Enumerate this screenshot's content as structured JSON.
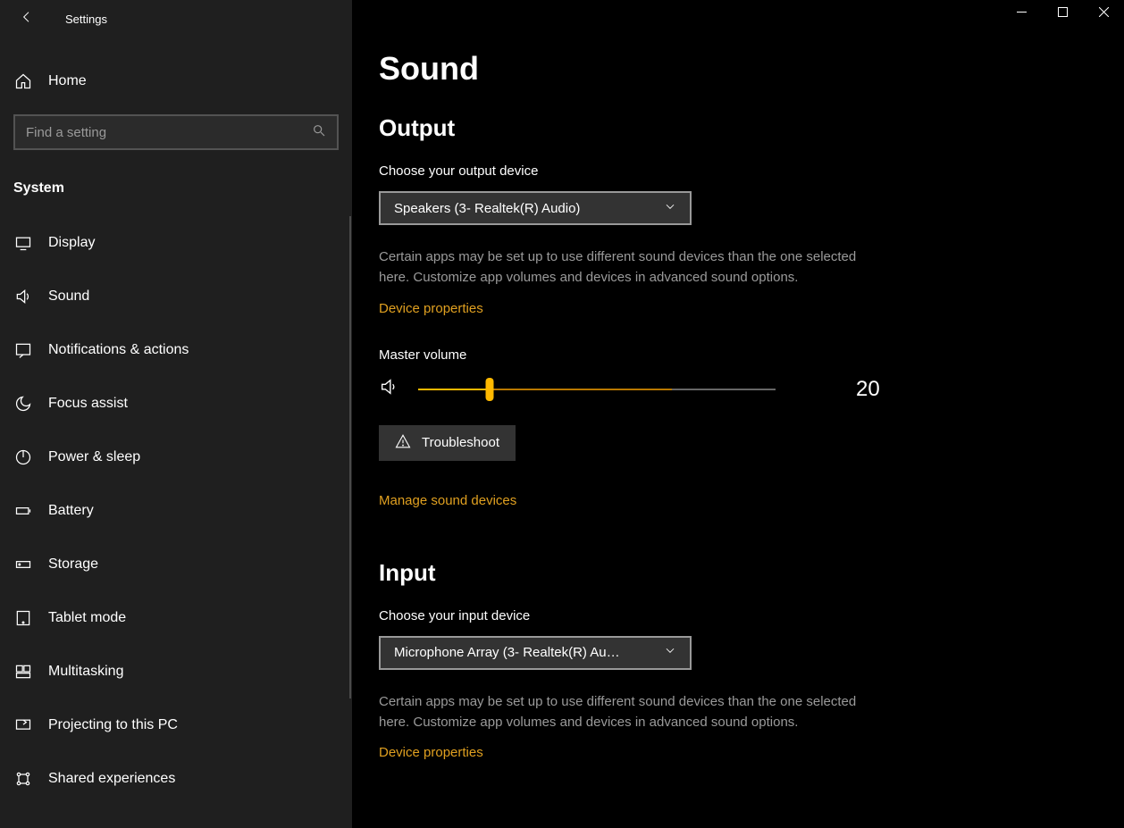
{
  "window": {
    "title": "Settings"
  },
  "sidebar": {
    "home": "Home",
    "search_placeholder": "Find a setting",
    "category": "System",
    "items": [
      {
        "id": "display",
        "icon": "display",
        "label": "Display"
      },
      {
        "id": "sound",
        "icon": "sound",
        "label": "Sound"
      },
      {
        "id": "notifications",
        "icon": "notifications",
        "label": "Notifications & actions"
      },
      {
        "id": "focus-assist",
        "icon": "focus-assist",
        "label": "Focus assist"
      },
      {
        "id": "power-sleep",
        "icon": "power-sleep",
        "label": "Power & sleep"
      },
      {
        "id": "battery",
        "icon": "battery",
        "label": "Battery"
      },
      {
        "id": "storage",
        "icon": "storage",
        "label": "Storage"
      },
      {
        "id": "tablet-mode",
        "icon": "tablet-mode",
        "label": "Tablet mode"
      },
      {
        "id": "multitasking",
        "icon": "multitasking",
        "label": "Multitasking"
      },
      {
        "id": "projecting",
        "icon": "projecting",
        "label": "Projecting to this PC"
      },
      {
        "id": "shared-exp",
        "icon": "shared-exp",
        "label": "Shared experiences"
      }
    ]
  },
  "main": {
    "page_title": "Sound",
    "output": {
      "heading": "Output",
      "choose_label": "Choose your output device",
      "selected": "Speakers (3- Realtek(R) Audio)",
      "help": "Certain apps may be set up to use different sound devices than the one selected here. Customize app volumes and devices in advanced sound options.",
      "device_properties": "Device properties",
      "master_volume_label": "Master volume",
      "volume_value": "20",
      "troubleshoot": "Troubleshoot",
      "manage_devices": "Manage sound devices"
    },
    "input": {
      "heading": "Input",
      "choose_label": "Choose your input device",
      "selected": "Microphone Array (3- Realtek(R) Au…",
      "help": "Certain apps may be set up to use different sound devices than the one selected here. Customize app volumes and devices in advanced sound options.",
      "device_properties": "Device properties"
    }
  },
  "colors": {
    "accent": "#ffb900",
    "link": "#e0a020"
  }
}
